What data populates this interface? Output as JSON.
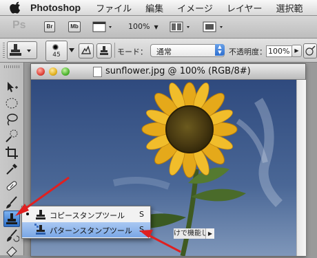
{
  "menubar": {
    "app_name": "Photoshop",
    "items": [
      "ファイル",
      "編集",
      "イメージ",
      "レイヤー",
      "選択範"
    ]
  },
  "appbar": {
    "logo": "Ps",
    "bridge_label": "Br",
    "minibridge_label": "Mb",
    "zoom": "100%"
  },
  "options": {
    "brush_size": "45",
    "mode_label": "モード：",
    "mode_value": "通常",
    "opacity_label": "不透明度：",
    "opacity_value": "100%"
  },
  "document": {
    "title": "sunflower.jpg @ 100% (RGB/8#)",
    "status_text": "けで機能し..."
  },
  "flyout": {
    "items": [
      {
        "label": "コピースタンプツール",
        "shortcut": "S"
      },
      {
        "label": "パターンスタンプツール",
        "shortcut": "S"
      }
    ]
  },
  "colors": {
    "accent": "#2e6fc8",
    "arrow": "#e02020",
    "sky": "#3f5a8c"
  }
}
